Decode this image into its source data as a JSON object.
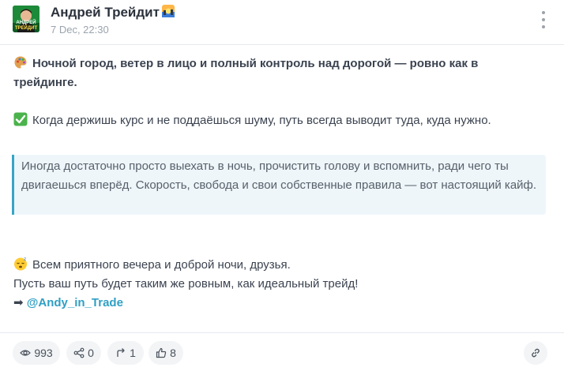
{
  "post": {
    "author": "Андрей Трейдит",
    "author_badge_icon": "sunrise-city-emoji",
    "timestamp": "7 Dec, 22:30",
    "avatar_text_top": "АНДРЕЙ",
    "avatar_text_bottom": "ТРЕЙДИТ",
    "line1_icon": "palette-emoji",
    "line1": "Ночной город, ветер в лицо и полный контроль над дорогой — ровно как в трейдинге.",
    "line2_icon": "check-mark-emoji",
    "line2": "Когда держишь курс и не поддаёшься шуму, путь всегда выводит туда, куда нужно.",
    "quote": "Иногда достаточно просто выехать в ночь, прочистить голову и вспомнить, ради чего ты двигаешься вперёд. Скорость, свобода и свои собственные правила — вот настоящий кайф.",
    "line3_icon": "sleeping-face-emoji",
    "line3": "Всем приятного вечера и доброй ночи, друзья.",
    "line4": "Пусть ваш путь будет таким же ровным, как идеальный трейд!",
    "line5_prefix": "➡",
    "line5_link": "@Andy_in_Trade"
  },
  "stats": {
    "views": "993",
    "shares": "0",
    "reposts": "1",
    "likes": "8"
  },
  "colors": {
    "accent": "#2f9fc4",
    "quote_border": "#37a5c6",
    "quote_bg": "#eef6fa",
    "avatar_bg": "#1d8a3a"
  }
}
